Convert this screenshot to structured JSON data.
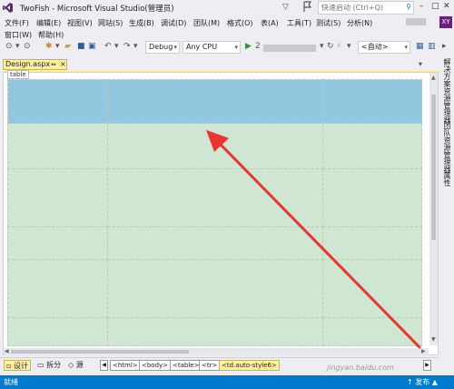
{
  "window": {
    "title": "TwoFish - Microsoft Visual Studio(管理员)",
    "quick_launch_placeholder": "快速启动 (Ctrl+Q)",
    "avatar_initials": "XY"
  },
  "menu": {
    "row1": [
      "文件(F)",
      "编辑(E)",
      "视图(V)",
      "网站(S)",
      "生成(B)",
      "调试(D)",
      "团队(M)",
      "格式(O)",
      "表(A)",
      "工具(T)",
      "测试(S)",
      "分析(N)"
    ],
    "row2": [
      "窗口(W)",
      "帮助(H)"
    ]
  },
  "toolbar": {
    "config": "Debug",
    "platform": "Any CPU",
    "run_label": "2",
    "auto": "<自动>"
  },
  "document": {
    "tab_label": "Design.aspx",
    "table_tag": "table",
    "table": {
      "rows": 6,
      "cols": 3,
      "header_rows": 1
    }
  },
  "side_panels": [
    "解决方案资源管理器",
    "团队资源管理器",
    "属性"
  ],
  "bottom": {
    "views": [
      "设计",
      "拆分",
      "源"
    ],
    "breadcrumbs": [
      "<html>",
      "<body>",
      "<table>",
      "<tr>",
      "<td.auto-style6>"
    ]
  },
  "status": {
    "left": "就绪",
    "right": "↑ 发布 ▲"
  },
  "watermark": "jingyan.baidu.com",
  "colors": {
    "header_cell": "#92c8df",
    "body_cell": "#cfe6d2",
    "accent": "#007acc",
    "tab_highlight": "#fff0a0",
    "annotation": "#e8352f"
  }
}
